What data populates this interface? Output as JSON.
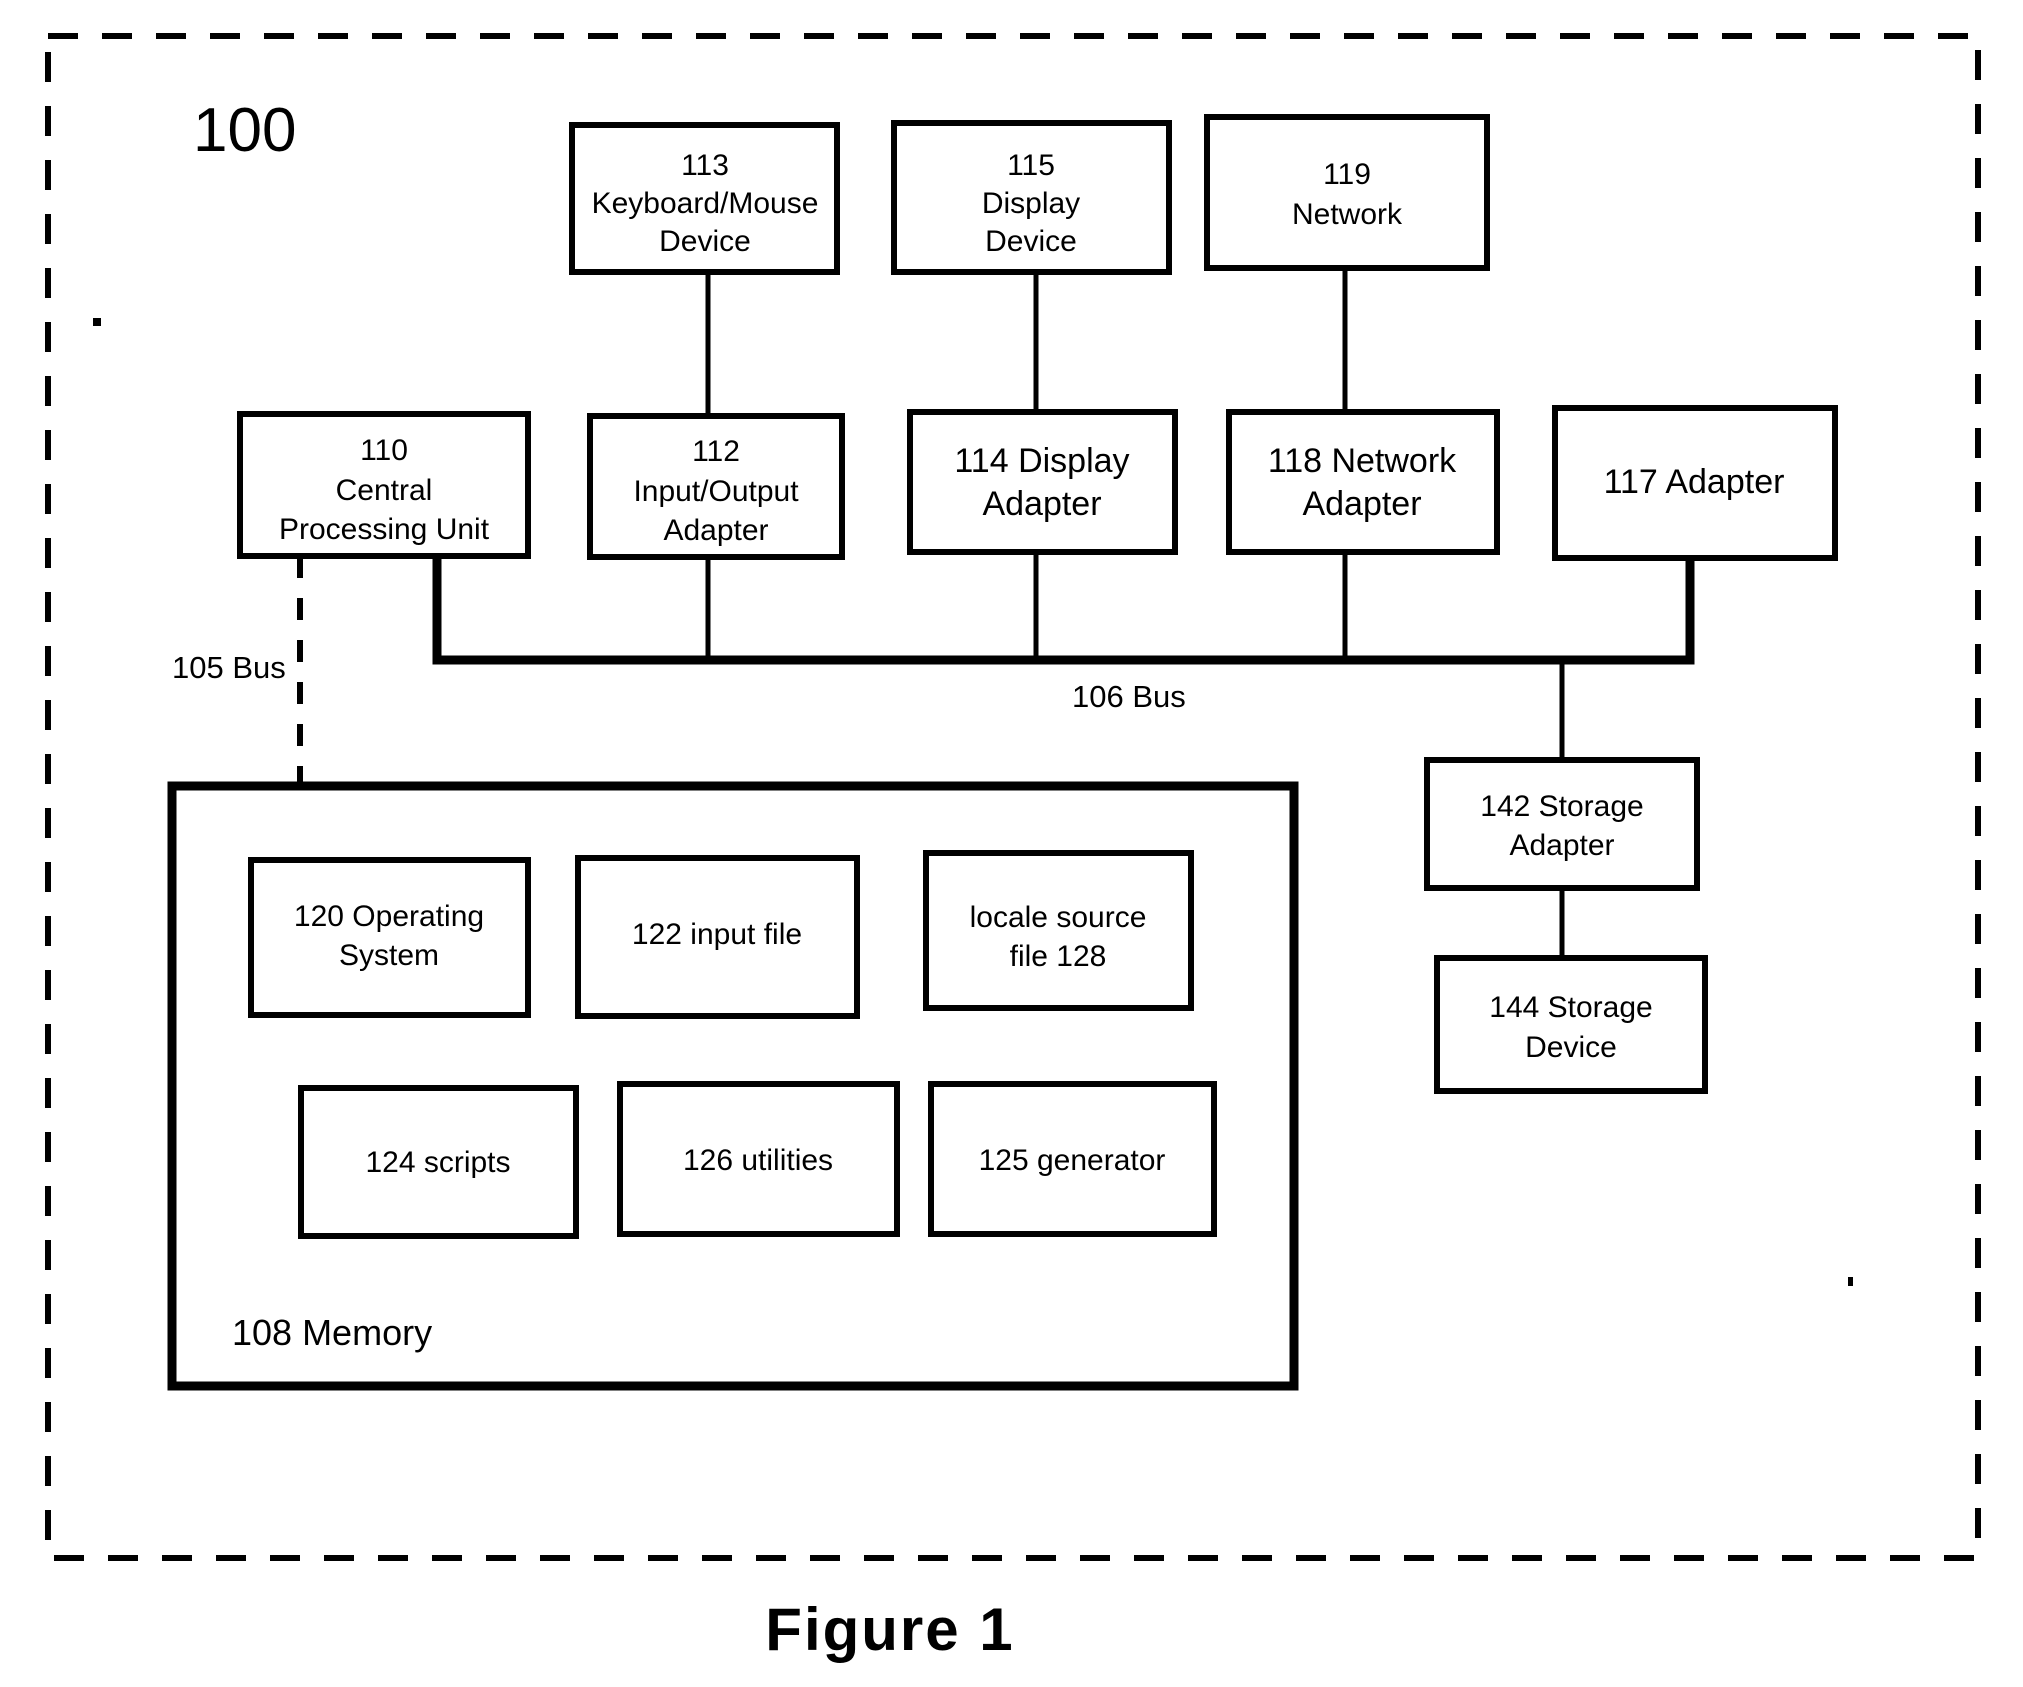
{
  "figure": {
    "caption": "Figure  1",
    "system_ref": "100"
  },
  "labels": {
    "bus_105": "105 Bus",
    "bus_106": "106 Bus",
    "memory": "108 Memory"
  },
  "nodes": {
    "keyboard_mouse_device": {
      "lines": [
        "113",
        "Keyboard/Mouse",
        "Device"
      ]
    },
    "display_device": {
      "lines": [
        "115",
        "Display",
        "Device"
      ]
    },
    "network": {
      "lines": [
        "119",
        "Network"
      ]
    },
    "cpu": {
      "lines": [
        "110",
        "Central",
        "Processing Unit"
      ]
    },
    "io_adapter": {
      "lines": [
        "112",
        "Input/Output",
        "Adapter"
      ]
    },
    "display_adapter": {
      "lines": [
        "114 Display",
        "Adapter"
      ]
    },
    "network_adapter": {
      "lines": [
        "118 Network",
        "Adapter"
      ]
    },
    "adapter_117": {
      "lines": [
        "117 Adapter"
      ]
    },
    "storage_adapter": {
      "lines": [
        "142 Storage",
        "Adapter"
      ]
    },
    "storage_device": {
      "lines": [
        "144 Storage",
        "Device"
      ]
    },
    "operating_system": {
      "lines": [
        "120 Operating",
        "System"
      ]
    },
    "input_file": {
      "lines": [
        "122 input file"
      ]
    },
    "locale_source_file": {
      "lines": [
        "locale source",
        "file 128"
      ]
    },
    "scripts": {
      "lines": [
        "124 scripts"
      ]
    },
    "utilities": {
      "lines": [
        "126 utilities"
      ]
    },
    "generator": {
      "lines": [
        "125 generator"
      ]
    }
  },
  "colors": {
    "ink": "#000000",
    "paper": "#ffffff"
  }
}
